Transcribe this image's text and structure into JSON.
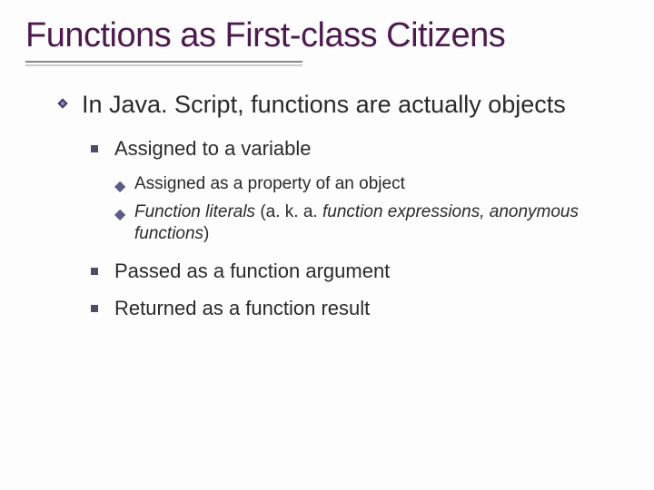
{
  "title": "Functions as First-class Citizens",
  "bullets": {
    "l1": "In Java. Script, functions are actually objects",
    "l2a": "Assigned to a variable",
    "l3a": "Assigned as a property of an object",
    "l3b_italic1": "Function literals",
    "l3b_plain": " (a. k. a. ",
    "l3b_italic2": "function expressions, anonymous functions",
    "l3b_close": ")",
    "l2b": "Passed as a function argument",
    "l2c": "Returned as a function result"
  }
}
